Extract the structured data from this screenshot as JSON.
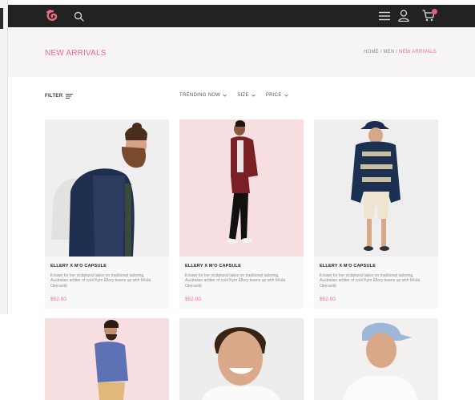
{
  "header": {
    "logo_icon": "swirl-logo-icon",
    "search_icon": "search-icon",
    "menu_icon": "hamburger-menu-icon",
    "user_icon": "user-icon",
    "cart_icon": "shopping-cart-icon",
    "accent_color": "#f06a83",
    "bar_color": "#222222"
  },
  "banner": {
    "title": "NEW ARRIVALS",
    "breadcrumb": [
      "HOME",
      "MEN",
      "NEW ARRIVALS"
    ]
  },
  "toolbar": {
    "filter_label": "FILTER",
    "sorts": [
      "TRENDING NOW",
      "SIZE",
      "PRICE"
    ]
  },
  "products": [
    {
      "name": "ELLERY X M'O CAPSULE",
      "description": "Known for her sculptural takes on traditional tailoring, Australian arbiter of cool Kym Ellery teams up with Moda Operandi.",
      "price": "$52.00"
    },
    {
      "name": "ELLERY X M'O CAPSULE",
      "description": "Known for her sculptural takes on traditional tailoring, Australian arbiter of cool Kym Ellery teams up with Moda Operandi.",
      "price": "$52.00"
    },
    {
      "name": "ELLERY X M'O CAPSULE",
      "description": "Known for her sculptural takes on traditional tailoring, Australian arbiter of cool Kym Ellery teams up with Moda Operandi.",
      "price": "$52.00"
    }
  ]
}
